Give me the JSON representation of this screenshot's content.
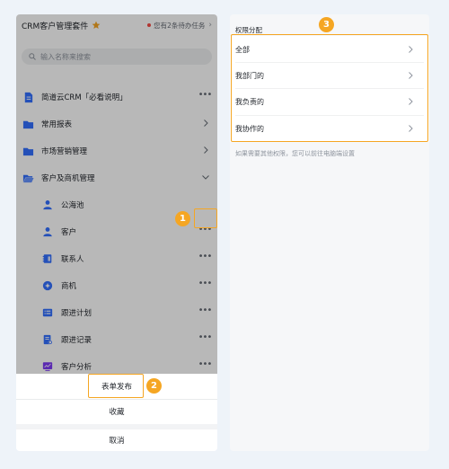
{
  "left": {
    "header": {
      "app_title": "CRM客户管理套件",
      "pending_text": "您有2条待办任务"
    },
    "search": {
      "placeholder": "输入名称来搜索"
    },
    "items": [
      {
        "label": "简道云CRM「必看说明」",
        "icon": "doc-icon",
        "color": "#3370ff"
      },
      {
        "label": "常用报表",
        "icon": "folder-icon",
        "color": "#3370ff"
      },
      {
        "label": "市场营销管理",
        "icon": "folder-icon",
        "color": "#3370ff"
      },
      {
        "label": "客户及商机管理",
        "icon": "folder-open-icon",
        "color": "#3370ff"
      },
      {
        "label": "公海池",
        "icon": "person-icon",
        "color": "#3370ff"
      },
      {
        "label": "客户",
        "icon": "person-icon",
        "color": "#3370ff"
      },
      {
        "label": "联系人",
        "icon": "contact-card-icon",
        "color": "#3370ff"
      },
      {
        "label": "商机",
        "icon": "opportunity-icon",
        "color": "#3370ff"
      },
      {
        "label": "跟进计划",
        "icon": "list-icon",
        "color": "#3370ff"
      },
      {
        "label": "跟进记录",
        "icon": "record-icon",
        "color": "#3370ff"
      },
      {
        "label": "客户分析",
        "icon": "chart-icon",
        "color": "#7f3bf5"
      }
    ],
    "sheet": {
      "publish_label": "表单发布",
      "favorite_label": "收藏",
      "cancel_label": "取消"
    }
  },
  "right": {
    "section_title": "权限分配",
    "options": [
      "全部",
      "我部门的",
      "我负责的",
      "我协作的"
    ],
    "note": "如果需要其他权限，您可以前往电脑端设置"
  },
  "callouts": [
    "1",
    "2",
    "3"
  ],
  "colors": {
    "accent": "#f5a623",
    "primary": "#3370ff",
    "pending_dot": "#f54a45"
  }
}
